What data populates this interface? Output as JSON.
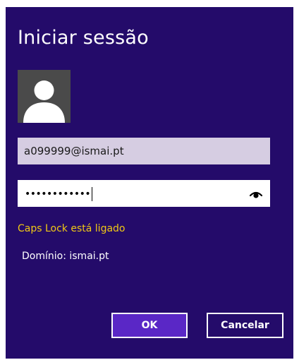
{
  "dialog": {
    "title": "Iniciar sessão",
    "username_value": "a099999@ismai.pt",
    "password_masked": "••••••••••••",
    "caps_lock_warning": "Caps Lock está ligado",
    "domain_text": "Domínio: ismai.pt",
    "ok_label": "OK",
    "cancel_label": "Cancelar"
  },
  "icons": {
    "avatar": "user-avatar-icon",
    "reveal": "eye-reveal-icon"
  },
  "colors": {
    "background": "#240b6a",
    "accent_button": "#5a27c6",
    "warning_text": "#f0c814",
    "username_field": "#d6cde2"
  }
}
